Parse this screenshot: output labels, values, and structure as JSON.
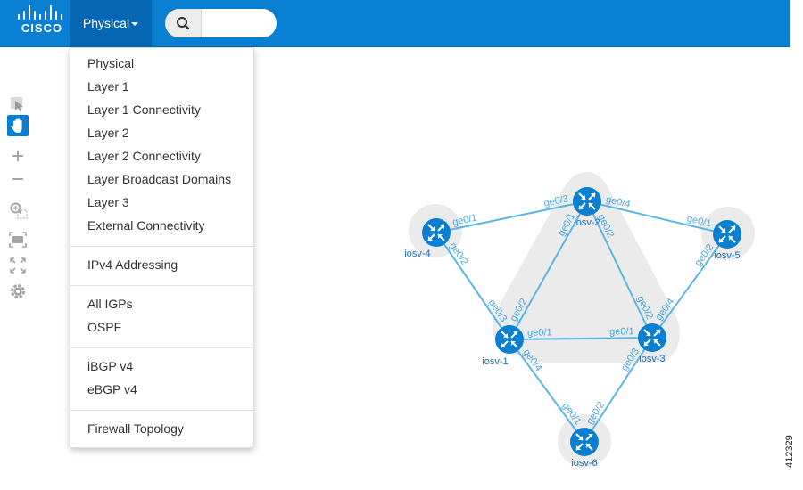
{
  "app": {
    "logo_text": "CISCO"
  },
  "header": {
    "view_label": "Physical",
    "search": {
      "value": "",
      "placeholder": ""
    }
  },
  "menu": {
    "groups": [
      [
        "Physical",
        "Layer 1",
        "Layer 1 Connectivity",
        "Layer 2",
        "Layer 2 Connectivity",
        "Layer Broadcast Domains",
        "Layer 3",
        "External Connectivity"
      ],
      [
        "IPv4 Addressing"
      ],
      [
        "All IGPs",
        "OSPF"
      ],
      [
        "iBGP v4",
        "eBGP v4"
      ],
      [
        "Firewall Topology"
      ]
    ]
  },
  "toolbar": {
    "icons": [
      "select-icon",
      "pan-hand-icon",
      "zoom-in-icon",
      "zoom-out-icon",
      "zoom-region-icon",
      "fit-screen-icon",
      "fullscreen-icon",
      "settings-gear-icon"
    ]
  },
  "topology": {
    "nodes": [
      "iosv-1",
      "iosv-2",
      "iosv-3",
      "iosv-4",
      "iosv-5",
      "iosv-6"
    ],
    "links": [
      {
        "from": "iosv-4",
        "to": "iosv-2",
        "from_if": "ge0/1",
        "to_if": "ge0/3"
      },
      {
        "from": "iosv-2",
        "to": "iosv-5",
        "from_if": "ge0/4",
        "to_if": "ge0/1"
      },
      {
        "from": "iosv-4",
        "to": "iosv-1",
        "from_if": "ge0/2",
        "to_if": "ge0/3"
      },
      {
        "from": "iosv-2",
        "to": "iosv-1",
        "from_if": "ge0/1",
        "to_if": "ge0/2"
      },
      {
        "from": "iosv-2",
        "to": "iosv-3",
        "from_if": "ge0/2",
        "to_if": "ge0/2"
      },
      {
        "from": "iosv-5",
        "to": "iosv-3",
        "from_if": "ge0/2",
        "to_if": "ge0/4"
      },
      {
        "from": "iosv-1",
        "to": "iosv-3",
        "from_if": "ge0/1",
        "to_if": "ge0/1"
      },
      {
        "from": "iosv-1",
        "to": "iosv-6",
        "from_if": "ge0/4",
        "to_if": "ge0/1"
      },
      {
        "from": "iosv-3",
        "to": "iosv-6",
        "from_if": "ge0/3",
        "to_if": "ge0/2"
      }
    ]
  },
  "figure_number": "412329",
  "colors": {
    "header": "#0a7fd2",
    "view_toggle": "#0566b3",
    "node": "#0a7fd2",
    "link": "#5bb6e6",
    "link_label": "#4aa8dc",
    "group_shade": "#ebebeb",
    "toolbar_icon": "#a6a6a6"
  }
}
